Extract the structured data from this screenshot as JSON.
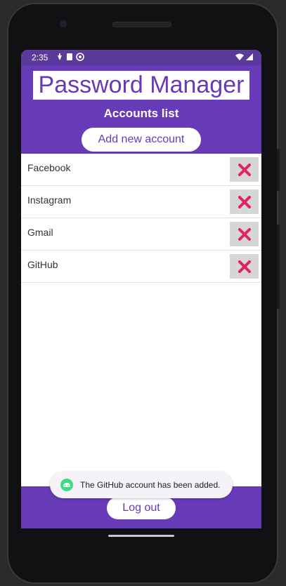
{
  "status_bar": {
    "time": "2:35"
  },
  "header": {
    "app_title": "Password Manager",
    "list_heading": "Accounts list",
    "add_button_label": "Add new account"
  },
  "accounts": [
    {
      "name": "Facebook"
    },
    {
      "name": "Instagram"
    },
    {
      "name": "Gmail"
    },
    {
      "name": "GitHub"
    }
  ],
  "footer": {
    "logout_label": "Log out"
  },
  "toast": {
    "message": "The GitHub account has been added."
  },
  "colors": {
    "primary": "#673ab7",
    "delete_icon": "#e0245e",
    "delete_button_bg": "#d6d6d6",
    "toast_icon": "#3ddc84"
  },
  "icons": {
    "delete": "close-icon",
    "toast": "android-icon"
  }
}
